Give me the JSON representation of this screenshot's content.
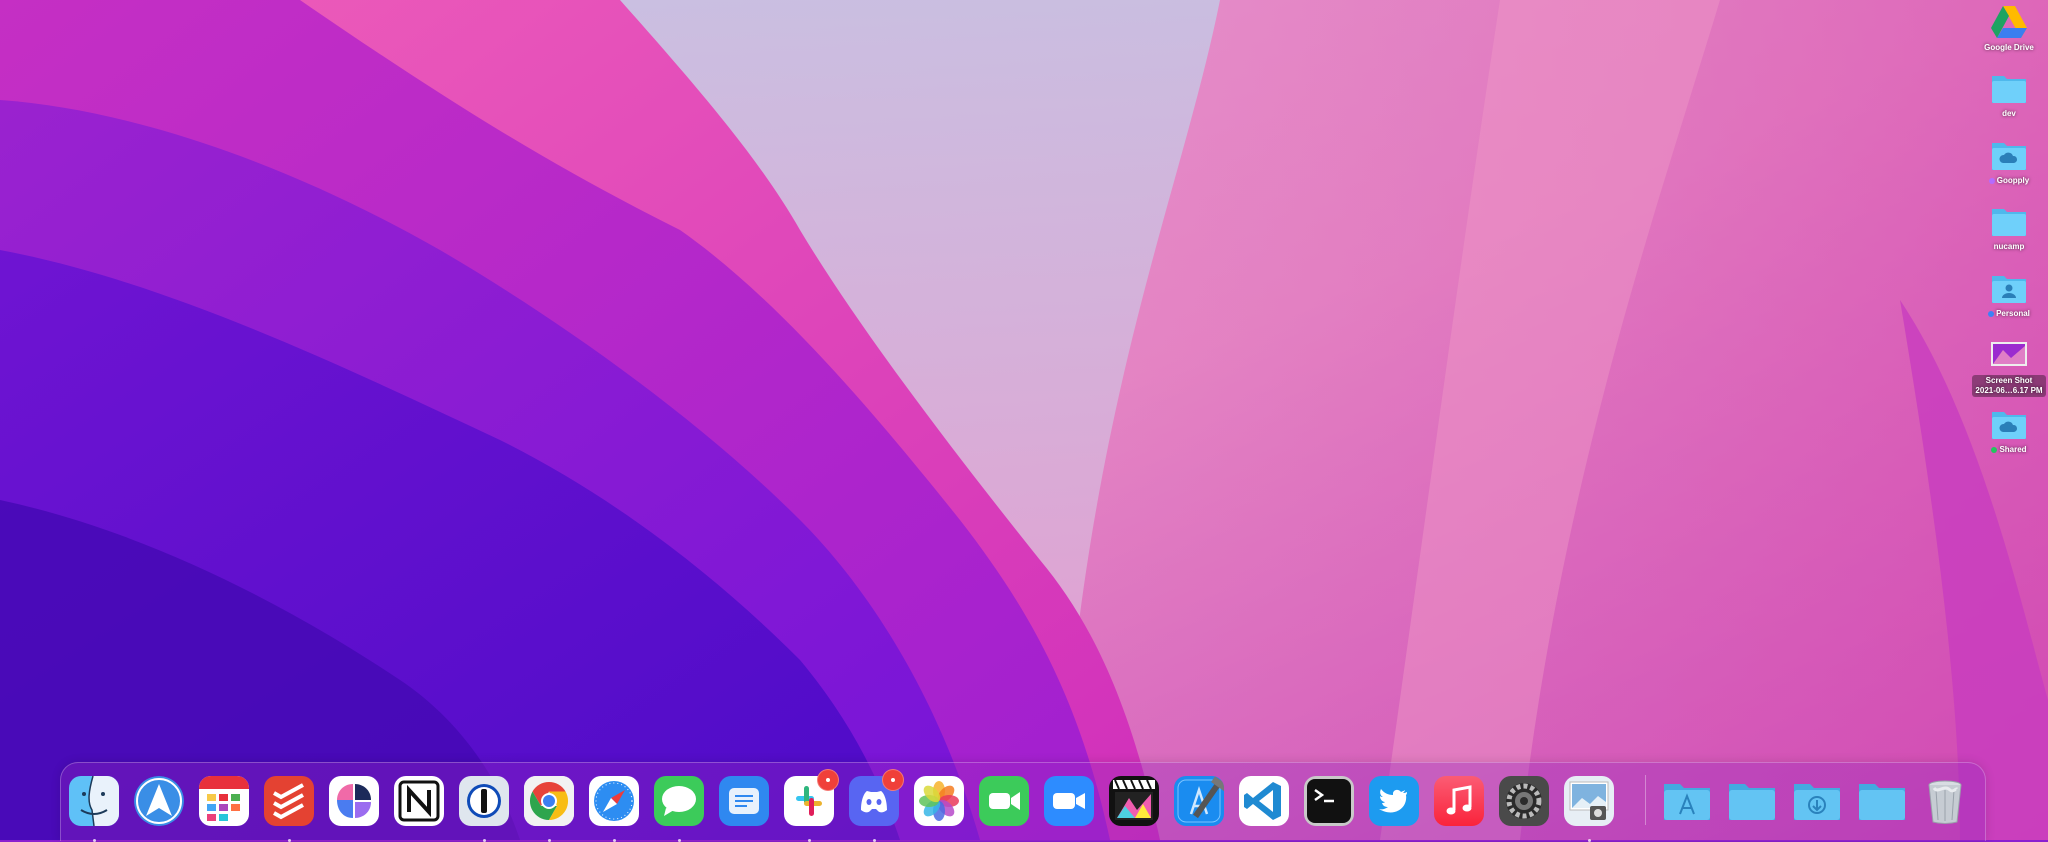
{
  "desktop": {
    "items": [
      {
        "label": "Google Drive",
        "icon": "google-drive-icon"
      },
      {
        "label": "dev",
        "icon": "folder-icon"
      },
      {
        "label": "Goopply",
        "icon": "cloud-folder-icon",
        "tag_color": "#b46bff"
      },
      {
        "label": "nucamp",
        "icon": "folder-icon"
      },
      {
        "label": "Personal",
        "icon": "person-folder-icon",
        "tag_color": "#3b82f6"
      },
      {
        "label_line1": "Screen Shot",
        "label_line2": "2021-06…6.17 PM",
        "icon": "screenshot-thumbnail-icon"
      },
      {
        "label": "Shared",
        "icon": "cloud-folder-icon",
        "tag_color": "#22c55e"
      }
    ]
  },
  "dock": {
    "apps": [
      {
        "name": "Finder",
        "icon": "finder-icon",
        "running": true
      },
      {
        "name": "Spark",
        "icon": "spark-icon",
        "running": false
      },
      {
        "name": "Fantastical",
        "icon": "calendar-icon",
        "running": false
      },
      {
        "name": "Todoist",
        "icon": "todoist-icon",
        "running": true
      },
      {
        "name": "Craft",
        "icon": "craft-icon",
        "running": false
      },
      {
        "name": "Notion",
        "icon": "notion-icon",
        "running": false
      },
      {
        "name": "1Password",
        "icon": "1password-icon",
        "running": true
      },
      {
        "name": "Google Chrome",
        "icon": "chrome-icon",
        "running": true
      },
      {
        "name": "Safari",
        "icon": "safari-icon",
        "running": true
      },
      {
        "name": "Messages",
        "icon": "messages-icon",
        "running": true
      },
      {
        "name": "Mail",
        "icon": "mail-icon",
        "running": false
      },
      {
        "name": "Slack",
        "icon": "slack-icon",
        "running": true,
        "badge": true
      },
      {
        "name": "Discord",
        "icon": "discord-icon",
        "running": true,
        "badge": true
      },
      {
        "name": "Photos",
        "icon": "photos-icon",
        "running": false
      },
      {
        "name": "FaceTime",
        "icon": "facetime-icon",
        "running": false
      },
      {
        "name": "Zoom",
        "icon": "zoom-icon",
        "running": false
      },
      {
        "name": "Final Cut Pro",
        "icon": "final-cut-icon",
        "running": false
      },
      {
        "name": "Xcode",
        "icon": "xcode-icon",
        "running": false
      },
      {
        "name": "Visual Studio Code",
        "icon": "vscode-icon",
        "running": false
      },
      {
        "name": "Terminal",
        "icon": "terminal-icon",
        "running": false
      },
      {
        "name": "Twitter",
        "icon": "twitter-icon",
        "running": false
      },
      {
        "name": "Music",
        "icon": "music-icon",
        "running": false
      },
      {
        "name": "System Preferences",
        "icon": "gear-icon",
        "running": false
      },
      {
        "name": "Preview",
        "icon": "preview-icon",
        "running": true
      }
    ],
    "stacks": [
      {
        "name": "Applications",
        "icon": "applications-folder-icon"
      },
      {
        "name": "Documents",
        "icon": "folder-icon"
      },
      {
        "name": "Downloads",
        "icon": "downloads-folder-icon"
      },
      {
        "name": "Folder",
        "icon": "folder-icon"
      },
      {
        "name": "Trash",
        "icon": "trash-icon"
      }
    ]
  },
  "colors": {
    "folder_blue": "#5ec6f6",
    "badge_red": "#f0403a"
  }
}
